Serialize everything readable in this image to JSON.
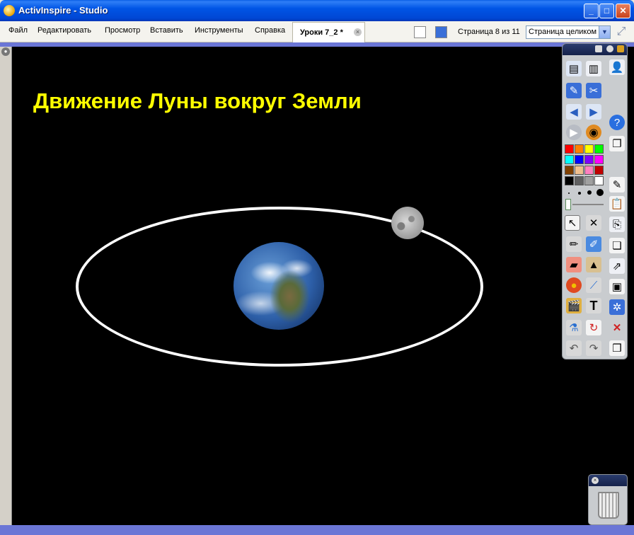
{
  "window": {
    "title": "ActivInspire - Studio"
  },
  "menu": [
    "Файл",
    "Редактировать",
    "Просмотр",
    "Вставить",
    "Инструменты",
    "Справка"
  ],
  "document_tab": {
    "label": "Уроки 7_2 *"
  },
  "page_info": "Страница 8 из 11",
  "zoom": {
    "selected": "Страница целиком"
  },
  "slide": {
    "title": "Движение Луны вокруг Земли",
    "title_color": "#ffff00",
    "background": "#000000"
  },
  "palette": [
    "#ff0000",
    "#ff8000",
    "#ffff00",
    "#00ff00",
    "#00ffff",
    "#0000ff",
    "#8000ff",
    "#ff00ff",
    "#804000",
    "#f0c090",
    "#ff80c0",
    "#c00000",
    "#000000",
    "#606060",
    "#a0a0a0",
    "#ffffff"
  ],
  "toolbox_icons": [
    "user-icon",
    "notes-icon",
    "edit-icon",
    "pen-icon",
    "tools-icon",
    "back-icon",
    "forward-icon",
    "help-icon",
    "play-icon",
    "browser-icon",
    "pages-icon",
    "select-icon",
    "magic-pen-icon",
    "marker-icon",
    "highlighter-icon",
    "eraser-icon",
    "fill-icon",
    "shape-icon",
    "connector-icon",
    "clipart-icon",
    "text-icon",
    "spotlight-icon",
    "reset-icon",
    "delete-icon",
    "undo-icon",
    "redo-icon"
  ]
}
